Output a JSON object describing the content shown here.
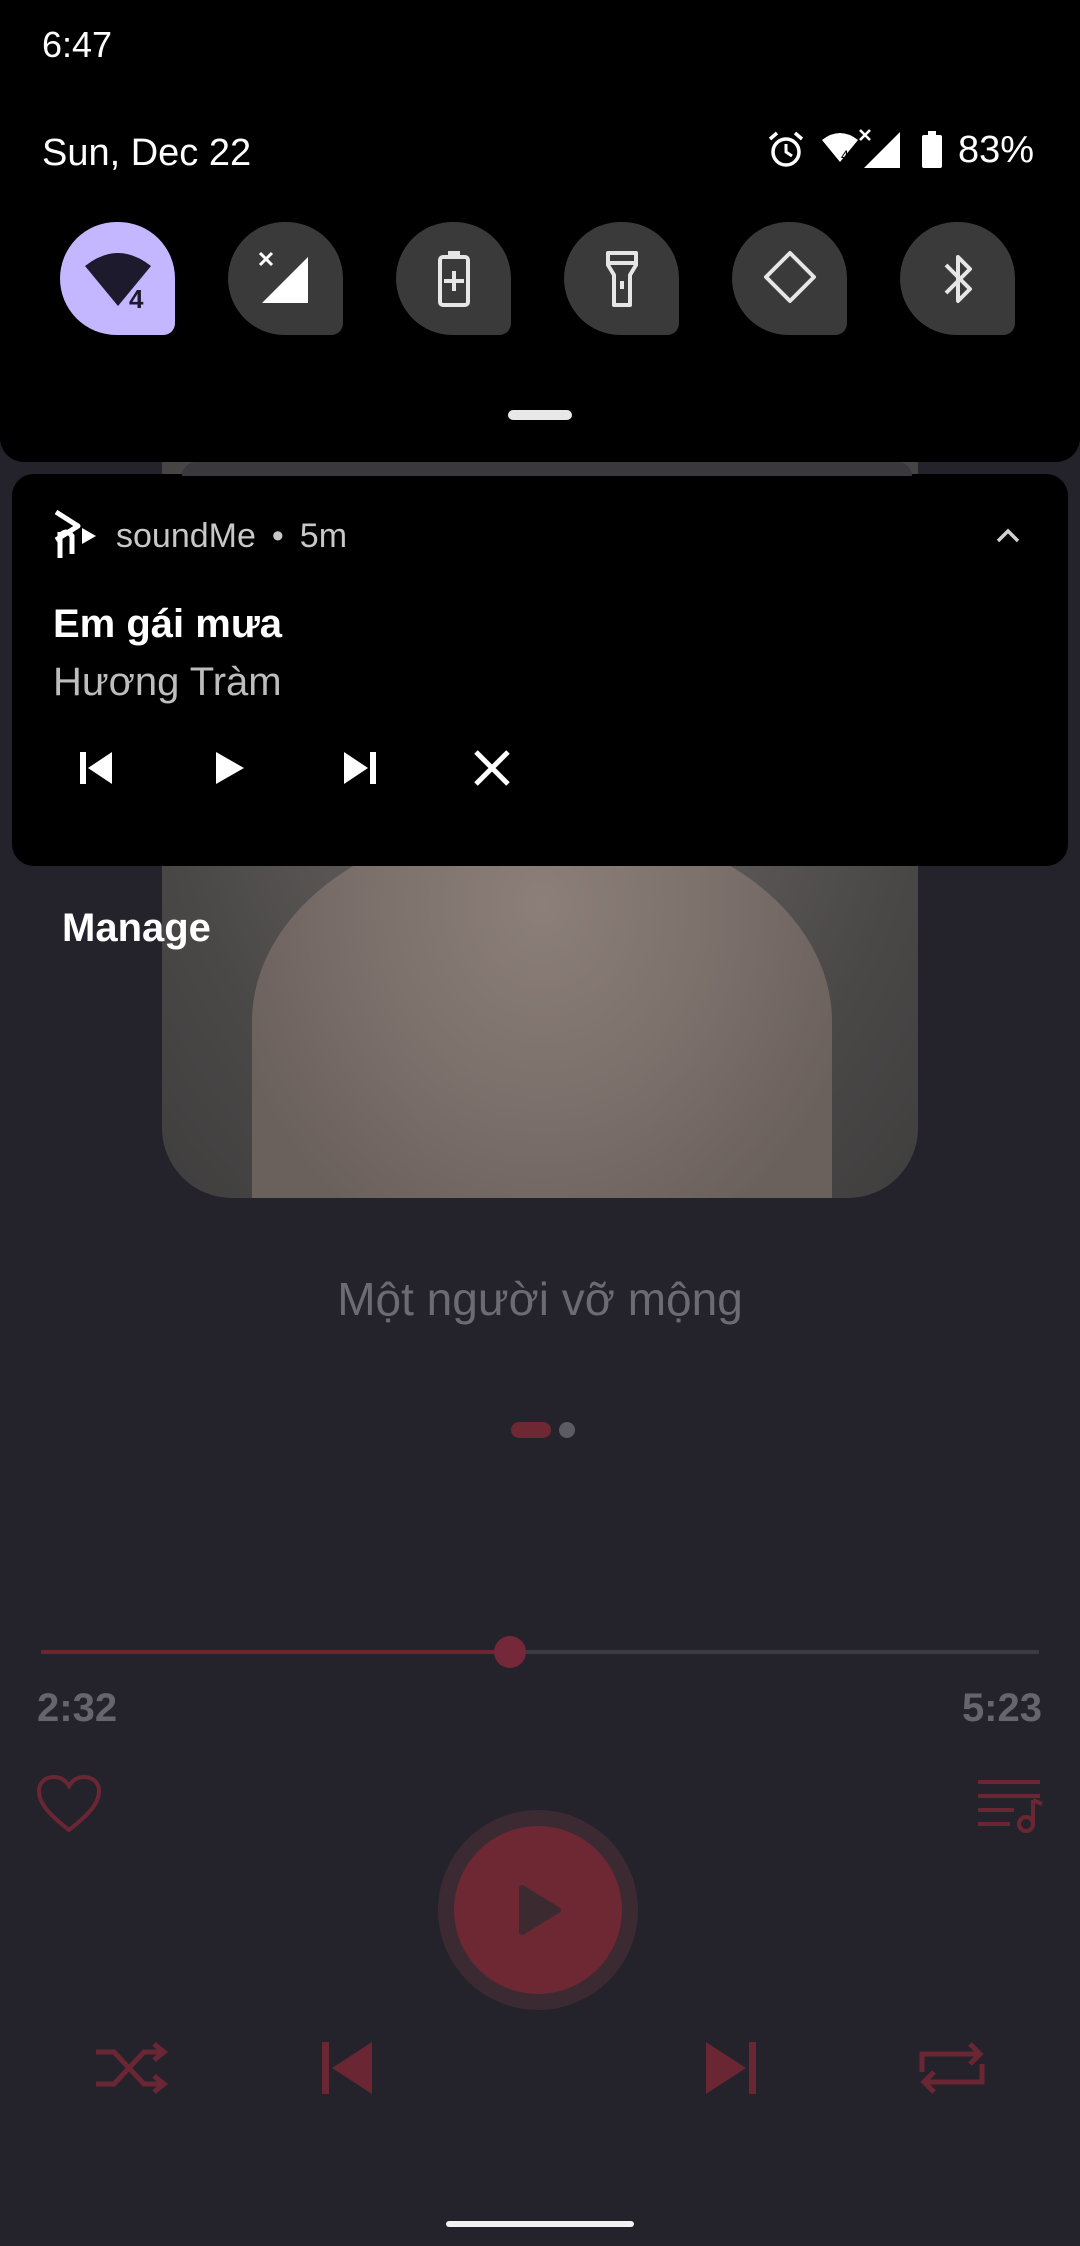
{
  "status_bar": {
    "clock": "6:47"
  },
  "quick_settings": {
    "date": "Sun, Dec 22",
    "battery_percent": "83%",
    "wifi_badge": "4",
    "tiles": [
      {
        "name": "wifi",
        "icon": "wifi-icon",
        "active": true
      },
      {
        "name": "mobile-data",
        "icon": "cellular-off-icon",
        "active": false
      },
      {
        "name": "battery-saver",
        "icon": "battery-saver-icon",
        "active": false
      },
      {
        "name": "flashlight",
        "icon": "flashlight-icon",
        "active": false
      },
      {
        "name": "auto-rotate",
        "icon": "rotate-icon",
        "active": false
      },
      {
        "name": "bluetooth",
        "icon": "bluetooth-icon",
        "active": false
      }
    ],
    "accent_color": "#c4b6ff"
  },
  "notification": {
    "app_name": "soundMe",
    "separator": "•",
    "time_ago": "5m",
    "title": "Em gái mưa",
    "artist": "Hương Tràm",
    "controls": [
      "previous-icon",
      "play-icon",
      "next-icon",
      "close-icon"
    ]
  },
  "manage_label": "Manage",
  "player": {
    "song_title": "Một người vỡ mộng",
    "elapsed": "2:32",
    "duration": "5:23",
    "progress": 0.47,
    "accent_color": "#6d2834"
  }
}
